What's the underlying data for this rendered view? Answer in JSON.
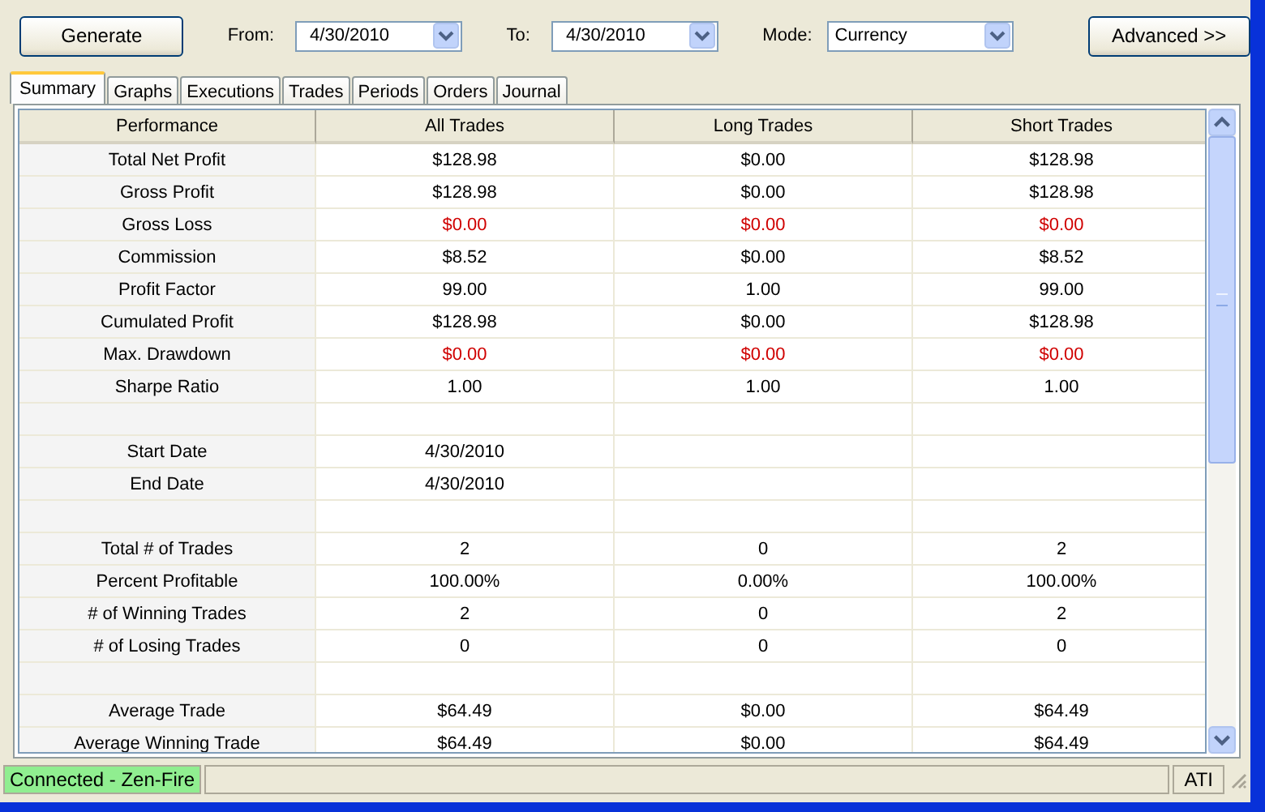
{
  "toolbar": {
    "generate_button": "Generate",
    "from_label": "From:",
    "from_value": "4/30/2010",
    "to_label": "To:",
    "to_value": "4/30/2010",
    "mode_label": "Mode:",
    "mode_value": "Currency",
    "advanced_button": "Advanced >>"
  },
  "tabs": [
    {
      "label": "Summary",
      "selected": true
    },
    {
      "label": "Graphs",
      "selected": false
    },
    {
      "label": "Executions",
      "selected": false
    },
    {
      "label": "Trades",
      "selected": false
    },
    {
      "label": "Periods",
      "selected": false
    },
    {
      "label": "Orders",
      "selected": false
    },
    {
      "label": "Journal",
      "selected": false
    }
  ],
  "table": {
    "columns": [
      "Performance",
      "All Trades",
      "Long Trades",
      "Short Trades"
    ],
    "rows": [
      {
        "kind": "data",
        "label": "Total Net Profit",
        "values": [
          "$128.98",
          "$0.00",
          "$128.98"
        ],
        "red": false
      },
      {
        "kind": "data",
        "label": "Gross Profit",
        "values": [
          "$128.98",
          "$0.00",
          "$128.98"
        ],
        "red": false
      },
      {
        "kind": "data",
        "label": "Gross Loss",
        "values": [
          "$0.00",
          "$0.00",
          "$0.00"
        ],
        "red": true
      },
      {
        "kind": "data",
        "label": "Commission",
        "values": [
          "$8.52",
          "$0.00",
          "$8.52"
        ],
        "red": false
      },
      {
        "kind": "data",
        "label": "Profit Factor",
        "values": [
          "99.00",
          "1.00",
          "99.00"
        ],
        "red": false
      },
      {
        "kind": "data",
        "label": "Cumulated Profit",
        "values": [
          "$128.98",
          "$0.00",
          "$128.98"
        ],
        "red": false
      },
      {
        "kind": "data",
        "label": "Max. Drawdown",
        "values": [
          "$0.00",
          "$0.00",
          "$0.00"
        ],
        "red": true
      },
      {
        "kind": "data",
        "label": "Sharpe Ratio",
        "values": [
          "1.00",
          "1.00",
          "1.00"
        ],
        "red": false
      },
      {
        "kind": "blank"
      },
      {
        "kind": "data",
        "label": "Start Date",
        "values": [
          "4/30/2010"
        ],
        "red": false
      },
      {
        "kind": "data",
        "label": "End Date",
        "values": [
          "4/30/2010"
        ],
        "red": false
      },
      {
        "kind": "blank"
      },
      {
        "kind": "data",
        "label": "Total # of Trades",
        "values": [
          "2",
          "0",
          "2"
        ],
        "red": false
      },
      {
        "kind": "data",
        "label": "Percent Profitable",
        "values": [
          "100.00%",
          "0.00%",
          "100.00%"
        ],
        "red": false
      },
      {
        "kind": "data",
        "label": "# of Winning Trades",
        "values": [
          "2",
          "0",
          "2"
        ],
        "red": false
      },
      {
        "kind": "data",
        "label": "# of Losing Trades",
        "values": [
          "0",
          "0",
          "0"
        ],
        "red": false
      },
      {
        "kind": "blank"
      },
      {
        "kind": "data",
        "label": "Average Trade",
        "values": [
          "$64.49",
          "$0.00",
          "$64.49"
        ],
        "red": false
      },
      {
        "kind": "data",
        "label": "Average Winning Trade",
        "values": [
          "$64.49",
          "$0.00",
          "$64.49"
        ],
        "red": false
      }
    ]
  },
  "status_bar": {
    "connection": "Connected - Zen-Fire",
    "right": "ATI"
  }
}
